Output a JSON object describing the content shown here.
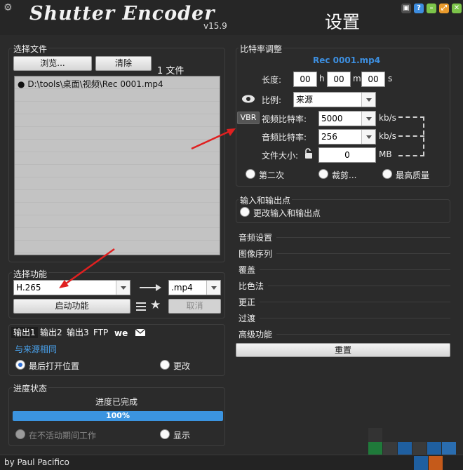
{
  "app": {
    "logo": "Shutter Encoder",
    "version": "v15.9",
    "settings_title": "设置",
    "author": "by Paul Pacifico"
  },
  "colors": {
    "accent_blue": "#3b94e0",
    "title_blue": "#3d8fe0",
    "window_bg": "#2b2b2b",
    "win_btn_green": "#7cc44a",
    "win_btn_orange": "#e99a2c",
    "win_btn_blue": "#3d8de0"
  },
  "file_section": {
    "title": "选择文件",
    "browse": "浏览...",
    "clear": "清除",
    "count": "1 文件",
    "files": [
      "D:\\tools\\桌面\\视频\\Rec 0001.mp4"
    ]
  },
  "function_section": {
    "title": "选择功能",
    "function_value": "H.265",
    "format_value": ".mp4",
    "start": "启动功能",
    "cancel": "取消"
  },
  "output_tabs": {
    "tabs": [
      "输出1",
      "输出2",
      "输出3",
      "FTP"
    ],
    "same_as_source": "与来源相同",
    "last_open": "最后打开位置",
    "change": "更改"
  },
  "progress_section": {
    "title": "进度状态",
    "status": "进度已完成",
    "percent_label": "100%",
    "percent_value": 100,
    "idle_work": "在不活动期间工作",
    "show": "显示"
  },
  "bitrate": {
    "title": "比特率调整",
    "filename": "Rec 0001.mp4",
    "length_label": "长度:",
    "h": "00",
    "h_unit": "h",
    "m": "00",
    "m_unit": "m",
    "s": "00",
    "s_unit": "s",
    "ratio_label": "比例:",
    "ratio_value": "来源",
    "vbr": "VBR",
    "video_label": "视频比特率:",
    "video_value": "5000",
    "video_unit": "kb/s",
    "audio_label": "音频比特率:",
    "audio_value": "256",
    "audio_unit": "kb/s",
    "size_label": "文件大小:",
    "size_value": "0",
    "size_unit": "MB",
    "opt_second": "第二次",
    "opt_crop": "裁剪...",
    "opt_quality": "最高质量"
  },
  "inout": {
    "title": "输入和输出点",
    "change": "更改输入和输出点"
  },
  "sections": [
    "音频设置",
    "图像序列",
    "覆盖",
    "比色法",
    "更正",
    "过渡",
    "高级功能"
  ],
  "reset": "重置"
}
